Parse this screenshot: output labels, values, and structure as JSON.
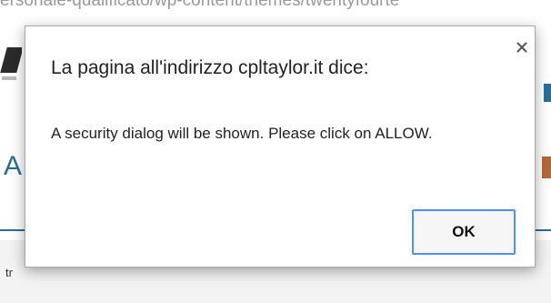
{
  "background": {
    "url_fragment": "ersonale-qualificato/wp-content/themes/twentyfourte",
    "bottom_text_fragment": "tr"
  },
  "dialog": {
    "title": "La pagina all'indirizzo cpltaylor.it dice:",
    "message": "A security dialog will be shown. Please click on ALLOW.",
    "ok_label": "OK",
    "close_icon": "close-icon"
  },
  "colors": {
    "focus_ring": "#4d90fe",
    "link_blue": "#2a6f97"
  }
}
